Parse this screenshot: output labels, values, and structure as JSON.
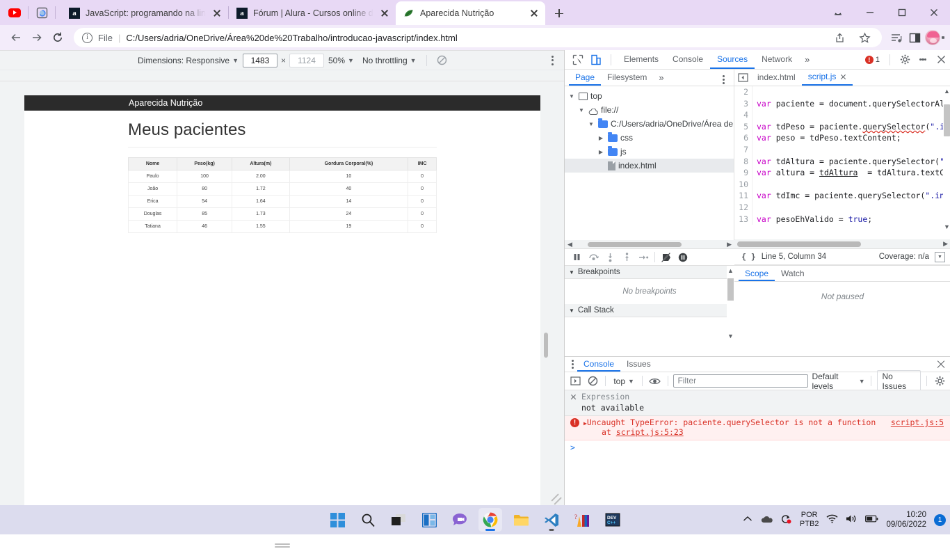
{
  "browser": {
    "tabs": [
      {
        "title": "JavaScript: programando na lingu",
        "favicon": "alura-icon",
        "active": false
      },
      {
        "title": "Fórum | Alura - Cursos online de",
        "favicon": "alura-icon",
        "active": false
      },
      {
        "title": "Aparecida Nutrição",
        "favicon": "leaf-icon",
        "active": true
      }
    ],
    "pinned_icons": [
      "youtube-icon",
      "reading-list-icon"
    ],
    "new_tab_label": "+",
    "omnibox": {
      "security_label": "File",
      "url": "C:/Users/adria/OneDrive/Área%20de%20Trabalho/introducao-javascript/index.html"
    },
    "toolbar_icons": [
      "share-icon",
      "bookmark-star-icon",
      "media-list-icon",
      "sidepanel-icon",
      "avatar",
      "browser-menu-icon"
    ],
    "window_controls": [
      "minimize-window",
      "maximize-window",
      "close-window"
    ]
  },
  "device_toolbar": {
    "dimensions_label": "Dimensions: Responsive",
    "width_value": "1483",
    "height_placeholder": "1124",
    "zoom_label": "50%",
    "throttling_label": "No throttling",
    "rotate_icon": "rotate-disabled-icon",
    "more_options": "device-more-options"
  },
  "page": {
    "header_title": "Aparecida Nutrição",
    "heading": "Meus pacientes",
    "table": {
      "columns": [
        "Nome",
        "Peso(kg)",
        "Altura(m)",
        "Gordura Corporal(%)",
        "IMC"
      ],
      "rows": [
        [
          "Paulo",
          "100",
          "2.00",
          "10",
          "0"
        ],
        [
          "João",
          "80",
          "1.72",
          "40",
          "0"
        ],
        [
          "Erica",
          "54",
          "1.64",
          "14",
          "0"
        ],
        [
          "Douglas",
          "85",
          "1.73",
          "24",
          "0"
        ],
        [
          "Tatiana",
          "46",
          "1.55",
          "19",
          "0"
        ]
      ]
    }
  },
  "devtools": {
    "panel_tabs": [
      "Elements",
      "Console",
      "Sources",
      "Network"
    ],
    "selected_panel": "Sources",
    "more_panels": "»",
    "error_count": "1",
    "settings_icon": "gear-icon",
    "menu_icon": "devtools-menu-icon",
    "close_icon": "devtools-close-icon",
    "inspect_icon": "inspect-element-icon",
    "device_toggle_icon": "device-toolbar-icon",
    "navigator": {
      "tabs": [
        "Page",
        "Filesystem"
      ],
      "selected_tab": "Page",
      "overflow": "»",
      "tree": [
        {
          "label": "top",
          "icon": "frame-icon",
          "depth": 0,
          "expanded": true,
          "selected": false
        },
        {
          "label": "file://",
          "icon": "cloud-icon",
          "depth": 1,
          "expanded": true,
          "selected": false
        },
        {
          "label": "C:/Users/adria/OneDrive/Área de",
          "icon": "folder-icon",
          "depth": 2,
          "expanded": true,
          "selected": false
        },
        {
          "label": "css",
          "icon": "folder-icon",
          "depth": 3,
          "expanded": false,
          "selected": false
        },
        {
          "label": "js",
          "icon": "folder-icon",
          "depth": 3,
          "expanded": false,
          "selected": false
        },
        {
          "label": "index.html",
          "icon": "file-icon",
          "depth": 3,
          "expanded": null,
          "selected": true
        }
      ]
    },
    "editor": {
      "tabs": [
        {
          "label": "index.html",
          "selected": false,
          "closable": false
        },
        {
          "label": "script.js",
          "selected": true,
          "closable": true
        }
      ],
      "lines": [
        {
          "n": "2",
          "text": ""
        },
        {
          "n": "3",
          "text": "var paciente = document.querySelectorAl"
        },
        {
          "n": "4",
          "text": ""
        },
        {
          "n": "5",
          "text": "var tdPeso = paciente.querySelector(\".i"
        },
        {
          "n": "6",
          "text": "var peso = tdPeso.textContent;"
        },
        {
          "n": "7",
          "text": ""
        },
        {
          "n": "8",
          "text": "var tdAltura = paciente.querySelector(\""
        },
        {
          "n": "9",
          "text": "var altura = tdAltura  = tdAltura.textC"
        },
        {
          "n": "10",
          "text": ""
        },
        {
          "n": "11",
          "text": "var tdImc = paciente.querySelector(\".in"
        },
        {
          "n": "12",
          "text": ""
        },
        {
          "n": "13",
          "text": "var pesoEhValido = true;"
        }
      ],
      "status": {
        "pretty_print_icon": "format-braces-icon",
        "cursor": "Line 5, Column 34",
        "coverage": "Coverage: n/a",
        "more_icon": "pretty-print-icon"
      }
    },
    "debugger": {
      "controls": [
        "pause-icon",
        "step-over-icon",
        "step-into-icon",
        "step-out-icon",
        "step-icon",
        "deactivate-breakpoints-icon",
        "pause-on-exceptions-icon"
      ],
      "sections": [
        {
          "title": "Breakpoints",
          "empty_text": "No breakpoints"
        },
        {
          "title": "Call Stack",
          "empty_text": ""
        }
      ],
      "scope_tabs": [
        "Scope",
        "Watch"
      ],
      "selected_scope_tab": "Scope",
      "not_paused_text": "Not paused"
    },
    "console": {
      "tabs": [
        "Console",
        "Issues"
      ],
      "selected_tab": "Console",
      "toolbar": {
        "sidebar_icon": "console-sidebar-icon",
        "clear_icon": "clear-console-icon",
        "context": "top",
        "eye_icon": "live-expression-icon",
        "filter_placeholder": "Filter",
        "levels_label": "Default levels",
        "issues_label": "No Issues",
        "settings_icon": "console-settings-icon"
      },
      "messages": [
        {
          "type": "live-expression",
          "label": "Expression",
          "value": "not available"
        },
        {
          "type": "error",
          "text": "Uncaught TypeError: paciente.querySelector is not a function",
          "source": "script.js:5",
          "stack": "at script.js:5:23",
          "stack_link": "script.js:5:23"
        }
      ],
      "prompt": ">"
    }
  },
  "taskbar": {
    "apps": [
      {
        "name": "start-button",
        "state": "idle"
      },
      {
        "name": "search-button",
        "state": "idle"
      },
      {
        "name": "task-view-button",
        "state": "idle"
      },
      {
        "name": "widgets-button",
        "state": "idle"
      },
      {
        "name": "chat-button",
        "state": "idle"
      },
      {
        "name": "chrome-taskbar-icon",
        "state": "active"
      },
      {
        "name": "file-explorer-taskbar-icon",
        "state": "idle"
      },
      {
        "name": "vscode-taskbar-icon",
        "state": "running"
      },
      {
        "name": "paint-taskbar-icon",
        "state": "idle"
      },
      {
        "name": "devcpp-taskbar-icon",
        "state": "idle"
      }
    ],
    "tray": {
      "overflow_icon": "show-hidden-icons",
      "onedrive_icon": "onedrive-icon",
      "update_icon": "windows-update-icon",
      "language_line1": "POR",
      "language_line2": "PTB2",
      "wifi_icon": "wifi-icon",
      "volume_icon": "volume-icon",
      "battery_icon": "battery-icon",
      "time": "10:20",
      "date": "09/06/2022",
      "notification_count": "1"
    }
  },
  "colors": {
    "tabstrip": "#e8d9f5",
    "toolbar": "#f3ecfa",
    "accent": "#1a73e8",
    "error": "#d93025",
    "page_header": "#2b2b2b",
    "taskbar": "#dcdcee"
  }
}
